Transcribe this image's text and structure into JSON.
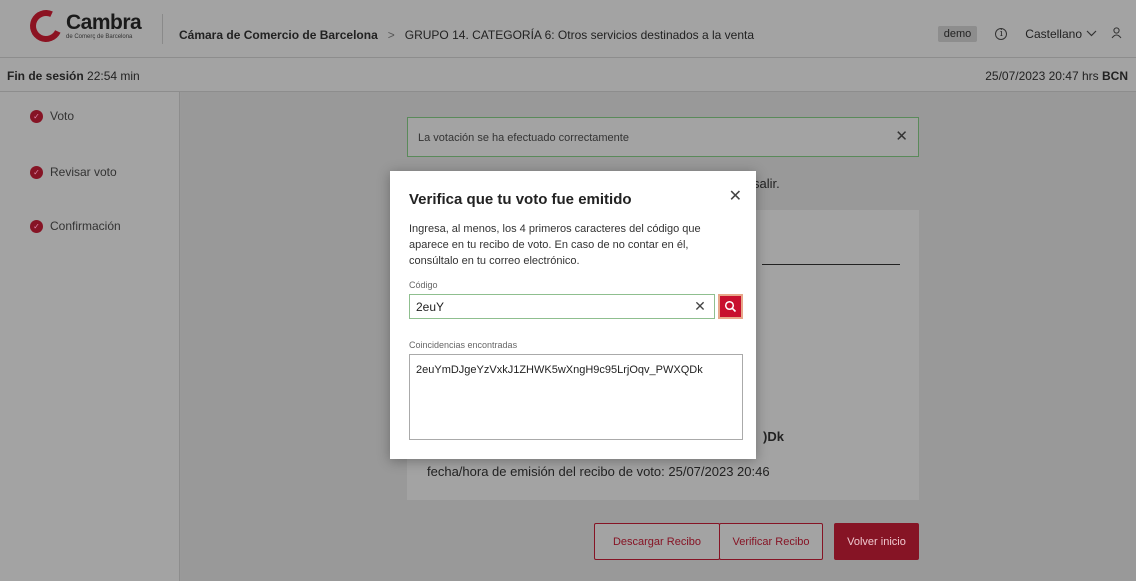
{
  "header": {
    "logo_name": "Cambra",
    "logo_sub": "de Comerç de Barcelona",
    "org": "Cámara de Comercio de Barcelona",
    "separator": ">",
    "group": "GRUPO 14. CATEGORÍA 6: Otros servicios destinados a la venta",
    "demo_badge": "demo",
    "info_glyph": "i",
    "language": "Castellano",
    "icons": {
      "info": "info-icon",
      "chevron": "chevron-down-icon",
      "user": "user-icon"
    }
  },
  "subheader": {
    "session_label": "Fin de sesión",
    "session_time": "22:54 min",
    "datetime": "25/07/2023 20:47 hrs",
    "city": "BCN"
  },
  "sidebar": {
    "items": [
      {
        "label": "Voto"
      },
      {
        "label": "Revisar voto"
      },
      {
        "label": "Confirmación"
      }
    ]
  },
  "main": {
    "alert_text": "La votación se ha efectuado correctamente",
    "partial_salir": "salir.",
    "partial_code": ")Dk",
    "emission_date": "fecha/hora de emisión del recibo de voto: 25/07/2023 20:46",
    "buttons": {
      "download": "Descargar Recibo",
      "verify": "Verificar Recibo",
      "home": "Volver inicio"
    }
  },
  "modal": {
    "title": "Verifica que tu voto fue emitido",
    "description": "Ingresa, al menos, los 4 primeros caracteres del código que aparece en tu recibo de voto. En caso de no contar en él, consúltalo en tu correo electrónico.",
    "code_label": "Código",
    "code_value": "2euY",
    "matches_label": "Coincidencias encontradas",
    "match": "2euYmDJgeYzVxkJ1ZHWK5wXngH9c95LrjOqv_PWXQDk"
  },
  "colors": {
    "brand": "#c8102e",
    "brand_dark": "#861425",
    "success_border": "#5a8a5a"
  }
}
